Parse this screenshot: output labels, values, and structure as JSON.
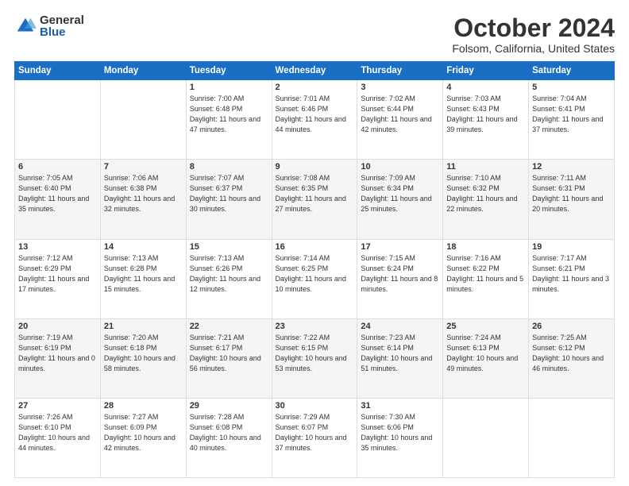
{
  "logo": {
    "general": "General",
    "blue": "Blue"
  },
  "header": {
    "month": "October 2024",
    "location": "Folsom, California, United States"
  },
  "days_of_week": [
    "Sunday",
    "Monday",
    "Tuesday",
    "Wednesday",
    "Thursday",
    "Friday",
    "Saturday"
  ],
  "weeks": [
    [
      {
        "day": "",
        "info": ""
      },
      {
        "day": "",
        "info": ""
      },
      {
        "day": "1",
        "info": "Sunrise: 7:00 AM\nSunset: 6:48 PM\nDaylight: 11 hours and 47 minutes."
      },
      {
        "day": "2",
        "info": "Sunrise: 7:01 AM\nSunset: 6:46 PM\nDaylight: 11 hours and 44 minutes."
      },
      {
        "day": "3",
        "info": "Sunrise: 7:02 AM\nSunset: 6:44 PM\nDaylight: 11 hours and 42 minutes."
      },
      {
        "day": "4",
        "info": "Sunrise: 7:03 AM\nSunset: 6:43 PM\nDaylight: 11 hours and 39 minutes."
      },
      {
        "day": "5",
        "info": "Sunrise: 7:04 AM\nSunset: 6:41 PM\nDaylight: 11 hours and 37 minutes."
      }
    ],
    [
      {
        "day": "6",
        "info": "Sunrise: 7:05 AM\nSunset: 6:40 PM\nDaylight: 11 hours and 35 minutes."
      },
      {
        "day": "7",
        "info": "Sunrise: 7:06 AM\nSunset: 6:38 PM\nDaylight: 11 hours and 32 minutes."
      },
      {
        "day": "8",
        "info": "Sunrise: 7:07 AM\nSunset: 6:37 PM\nDaylight: 11 hours and 30 minutes."
      },
      {
        "day": "9",
        "info": "Sunrise: 7:08 AM\nSunset: 6:35 PM\nDaylight: 11 hours and 27 minutes."
      },
      {
        "day": "10",
        "info": "Sunrise: 7:09 AM\nSunset: 6:34 PM\nDaylight: 11 hours and 25 minutes."
      },
      {
        "day": "11",
        "info": "Sunrise: 7:10 AM\nSunset: 6:32 PM\nDaylight: 11 hours and 22 minutes."
      },
      {
        "day": "12",
        "info": "Sunrise: 7:11 AM\nSunset: 6:31 PM\nDaylight: 11 hours and 20 minutes."
      }
    ],
    [
      {
        "day": "13",
        "info": "Sunrise: 7:12 AM\nSunset: 6:29 PM\nDaylight: 11 hours and 17 minutes."
      },
      {
        "day": "14",
        "info": "Sunrise: 7:13 AM\nSunset: 6:28 PM\nDaylight: 11 hours and 15 minutes."
      },
      {
        "day": "15",
        "info": "Sunrise: 7:13 AM\nSunset: 6:26 PM\nDaylight: 11 hours and 12 minutes."
      },
      {
        "day": "16",
        "info": "Sunrise: 7:14 AM\nSunset: 6:25 PM\nDaylight: 11 hours and 10 minutes."
      },
      {
        "day": "17",
        "info": "Sunrise: 7:15 AM\nSunset: 6:24 PM\nDaylight: 11 hours and 8 minutes."
      },
      {
        "day": "18",
        "info": "Sunrise: 7:16 AM\nSunset: 6:22 PM\nDaylight: 11 hours and 5 minutes."
      },
      {
        "day": "19",
        "info": "Sunrise: 7:17 AM\nSunset: 6:21 PM\nDaylight: 11 hours and 3 minutes."
      }
    ],
    [
      {
        "day": "20",
        "info": "Sunrise: 7:19 AM\nSunset: 6:19 PM\nDaylight: 11 hours and 0 minutes."
      },
      {
        "day": "21",
        "info": "Sunrise: 7:20 AM\nSunset: 6:18 PM\nDaylight: 10 hours and 58 minutes."
      },
      {
        "day": "22",
        "info": "Sunrise: 7:21 AM\nSunset: 6:17 PM\nDaylight: 10 hours and 56 minutes."
      },
      {
        "day": "23",
        "info": "Sunrise: 7:22 AM\nSunset: 6:15 PM\nDaylight: 10 hours and 53 minutes."
      },
      {
        "day": "24",
        "info": "Sunrise: 7:23 AM\nSunset: 6:14 PM\nDaylight: 10 hours and 51 minutes."
      },
      {
        "day": "25",
        "info": "Sunrise: 7:24 AM\nSunset: 6:13 PM\nDaylight: 10 hours and 49 minutes."
      },
      {
        "day": "26",
        "info": "Sunrise: 7:25 AM\nSunset: 6:12 PM\nDaylight: 10 hours and 46 minutes."
      }
    ],
    [
      {
        "day": "27",
        "info": "Sunrise: 7:26 AM\nSunset: 6:10 PM\nDaylight: 10 hours and 44 minutes."
      },
      {
        "day": "28",
        "info": "Sunrise: 7:27 AM\nSunset: 6:09 PM\nDaylight: 10 hours and 42 minutes."
      },
      {
        "day": "29",
        "info": "Sunrise: 7:28 AM\nSunset: 6:08 PM\nDaylight: 10 hours and 40 minutes."
      },
      {
        "day": "30",
        "info": "Sunrise: 7:29 AM\nSunset: 6:07 PM\nDaylight: 10 hours and 37 minutes."
      },
      {
        "day": "31",
        "info": "Sunrise: 7:30 AM\nSunset: 6:06 PM\nDaylight: 10 hours and 35 minutes."
      },
      {
        "day": "",
        "info": ""
      },
      {
        "day": "",
        "info": ""
      }
    ]
  ]
}
